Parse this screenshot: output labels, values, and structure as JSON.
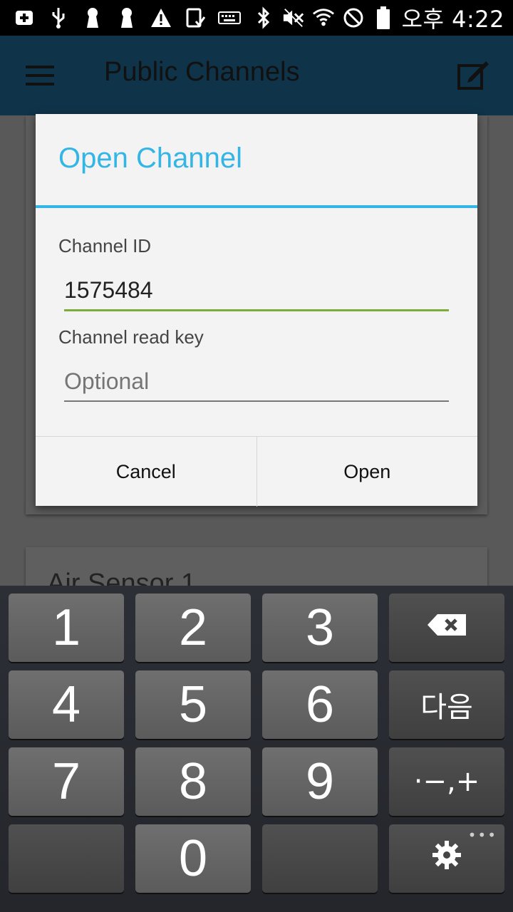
{
  "status_bar": {
    "time": "오후 4:22",
    "icons": [
      "add-box-icon",
      "usb-icon",
      "keyhole-icon",
      "keyhole-icon",
      "warning-icon",
      "screenshot-icon",
      "keyboard-icon",
      "bluetooth-icon",
      "mute-icon",
      "wifi-icon",
      "block-icon",
      "battery-icon"
    ]
  },
  "app_bar": {
    "title": "Public Channels",
    "menu_icon": "hamburger-icon",
    "action_icon": "compose-icon",
    "color": "#1c5e86"
  },
  "background": {
    "card_title": "Air Sensor 1"
  },
  "dialog": {
    "title": "Open Channel",
    "accent": "#33b5e5",
    "channel_id": {
      "label": "Channel ID",
      "value": "1575484"
    },
    "read_key": {
      "label": "Channel read key",
      "placeholder": "Optional"
    },
    "buttons": {
      "cancel": "Cancel",
      "open": "Open"
    }
  },
  "keyboard": {
    "keys": {
      "k1": "1",
      "k2": "2",
      "k3": "3",
      "k4": "4",
      "k5": "5",
      "k6": "6",
      "k7": "7",
      "k8": "8",
      "k9": "9",
      "k0": "0",
      "next": "다음",
      "symbols": "·−,+"
    },
    "backspace_icon": "backspace-icon",
    "settings_icon": "gear-icon",
    "more": "•••"
  }
}
